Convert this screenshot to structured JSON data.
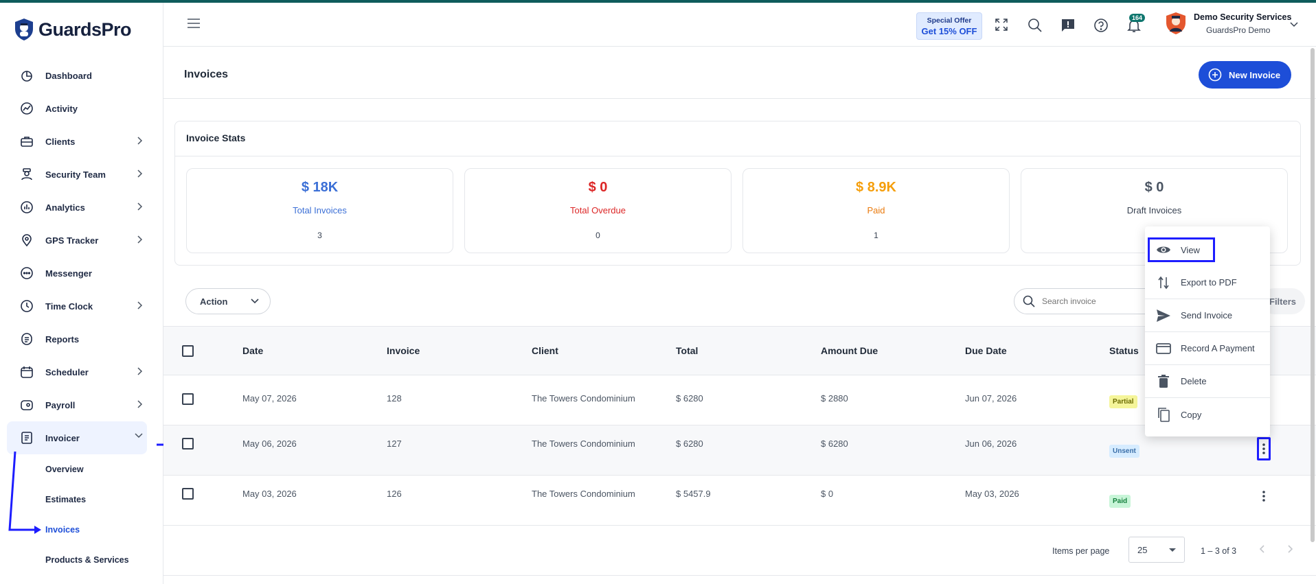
{
  "brand": {
    "name": "GuardsPro"
  },
  "sidebar": {
    "items": [
      {
        "label": "Dashboard",
        "icon": "dashboard-icon",
        "has_children": false
      },
      {
        "label": "Activity",
        "icon": "activity-icon",
        "has_children": false
      },
      {
        "label": "Clients",
        "icon": "briefcase-icon",
        "has_children": true
      },
      {
        "label": "Security Team",
        "icon": "guard-icon",
        "has_children": true
      },
      {
        "label": "Analytics",
        "icon": "analytics-icon",
        "has_children": true
      },
      {
        "label": "GPS Tracker",
        "icon": "location-icon",
        "has_children": true
      },
      {
        "label": "Messenger",
        "icon": "chat-icon",
        "has_children": false
      },
      {
        "label": "Time Clock",
        "icon": "clock-icon",
        "has_children": true
      },
      {
        "label": "Reports",
        "icon": "report-icon",
        "has_children": false
      },
      {
        "label": "Scheduler",
        "icon": "calendar-icon",
        "has_children": true
      },
      {
        "label": "Payroll",
        "icon": "wallet-icon",
        "has_children": true
      },
      {
        "label": "Invoicer",
        "icon": "invoice-icon",
        "has_children": true,
        "expanded": true
      }
    ],
    "invoicer_sub": [
      "Overview",
      "Estimates",
      "Invoices",
      "Products & Services"
    ],
    "current_sub": "Invoices"
  },
  "header": {
    "offer_line1": "Special Offer",
    "offer_line2": "Get 15% OFF",
    "notification_count": "164",
    "company": "Demo Security Services",
    "user": "GuardsPro Demo"
  },
  "page": {
    "title": "Invoices",
    "new_button": "New Invoice"
  },
  "stats": {
    "title": "Invoice Stats",
    "cards": [
      {
        "value": "$ 18K",
        "label": "Total Invoices",
        "count": "3",
        "color": "#3b6fd6"
      },
      {
        "value": "$ 0",
        "label": "Total Overdue",
        "count": "0",
        "color": "#dc2626"
      },
      {
        "value": "$ 8.9K",
        "label": "Paid",
        "count": "1",
        "color": "#f59e0b"
      },
      {
        "value": "$ 0",
        "label": "Draft Invoices",
        "count": "",
        "color": "#4b5563"
      }
    ]
  },
  "toolbar": {
    "action_label": "Action",
    "search_placeholder": "Search invoice",
    "filters_label": "Filters"
  },
  "table": {
    "columns": [
      "Date",
      "Invoice",
      "Client",
      "Total",
      "Amount Due",
      "Due Date",
      "Status"
    ],
    "rows": [
      {
        "date": "May 07, 2026",
        "invoice": "128",
        "client": "The Towers Condominium",
        "total": "$ 6280",
        "amount_due": "$ 2880",
        "due_date": "Jun 07, 2026",
        "status": "Partial",
        "status_bg": "#f5f59a",
        "status_fg": "#6b6b00"
      },
      {
        "date": "May 06, 2026",
        "invoice": "127",
        "client": "The Towers Condominium",
        "total": "$ 6280",
        "amount_due": "$ 6280",
        "due_date": "Jun 06, 2026",
        "status": "Unsent",
        "status_bg": "#d6ecff",
        "status_fg": "#3b6fa8"
      },
      {
        "date": "May 03, 2026",
        "invoice": "126",
        "client": "The Towers Condominium",
        "total": "$ 5457.9",
        "amount_due": "$ 0",
        "due_date": "May 03, 2026",
        "status": "Paid",
        "status_bg": "#c8f5d8",
        "status_fg": "#15803d"
      }
    ]
  },
  "pagination": {
    "items_per_page_label": "Items per page",
    "items_per_page": "25",
    "range": "1 – 3 of 3"
  },
  "context_menu": {
    "items": [
      {
        "label": "View",
        "icon": "eye-icon"
      },
      {
        "label": "Export to PDF",
        "icon": "export-icon"
      },
      {
        "label": "Send Invoice",
        "icon": "send-icon"
      },
      {
        "label": "Record A Payment",
        "icon": "card-icon"
      },
      {
        "label": "Delete",
        "icon": "trash-icon"
      },
      {
        "label": "Copy",
        "icon": "copy-icon"
      }
    ]
  },
  "annotation_color": "#1d1dff"
}
